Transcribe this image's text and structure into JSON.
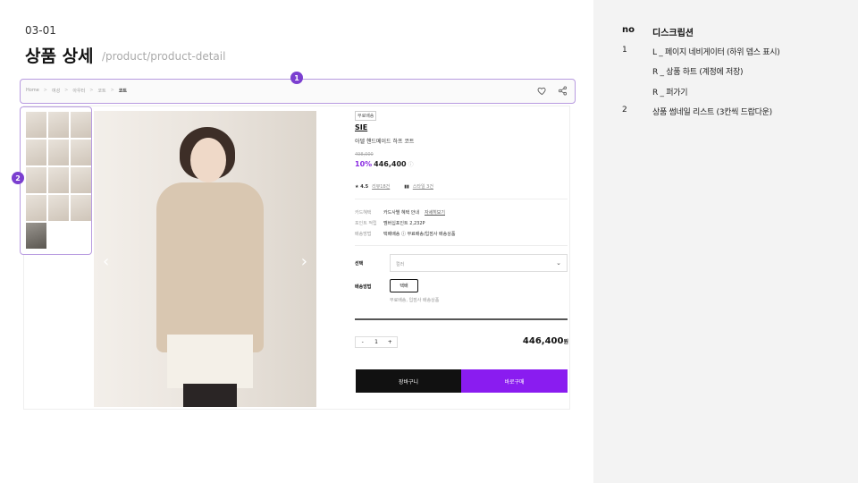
{
  "header": {
    "page_id": "03-01",
    "title": "상품 상세",
    "path": "/product/product-detail"
  },
  "breadcrumb": {
    "items": [
      "Home",
      "여성",
      "아우터",
      "코트"
    ],
    "current": "코트"
  },
  "markers": [
    "1",
    "2"
  ],
  "thumbnails_count": 13,
  "product": {
    "badge": "무료배송",
    "brand": "SIE",
    "name": "아델 핸드메이드 하프 코트",
    "original_price": "498,000",
    "discount_rate": "10%",
    "price": "446,400",
    "price_info_icon": "ⓘ",
    "rating": "★ 4.5",
    "review_link": "리뷰18건",
    "style_link": "스타일 3건",
    "benefits": [
      {
        "key": "카드혜택",
        "value": "카드사별 혜택 안내",
        "link": "자세히보기"
      },
      {
        "key": "포인트 적립",
        "value": "멤버십포인트 2,232P",
        "link": ""
      },
      {
        "key": "배송방법",
        "value": "택배배송 ⓘ  무료배송/입점사 배송상품",
        "link": ""
      }
    ],
    "option_label": "선택",
    "option_placeholder": "컬러",
    "ship_method_label": "배송방법",
    "ship_method_value": "택배",
    "ship_note": "무료배송, 입점사 배송상품",
    "qty_minus": "-",
    "qty": "1",
    "qty_plus": "+",
    "total": "446,400",
    "total_unit": "원",
    "cart_label": "장바구니",
    "buy_label": "바로구매",
    "arrow_left": "‹",
    "arrow_right": "›"
  },
  "description": {
    "col_no": "no",
    "col_desc": "디스크립션",
    "rows": [
      {
        "no": "1",
        "text": "L _ 페이지 네비게이터 (하위 뎁스 표시)"
      },
      {
        "no": "",
        "text": "R _ 상품 하트 (계정에 저장)"
      },
      {
        "no": "",
        "text": "R _ 퍼가기"
      },
      {
        "no": "2",
        "text": "상품 썸네일 리스트 (3칸씩 드랍다운)"
      }
    ]
  },
  "colors": {
    "accent": "#8a1cf0",
    "marker": "#7b3fd0",
    "outline": "#b89be0"
  }
}
